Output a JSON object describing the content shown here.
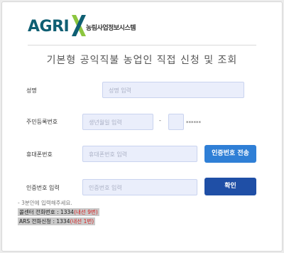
{
  "logo": {
    "brand": "AGRI",
    "brand_x": "X",
    "subtitle": "농림사업정보시스템"
  },
  "title": "기본형 공익직불 농업인 직접 신청 및 조회",
  "form": {
    "name": {
      "label": "성명",
      "placeholder": "성명 입력"
    },
    "resident": {
      "label": "주민등록번호",
      "birth_placeholder": "생년월일 입력",
      "dash": "-",
      "mask": "******"
    },
    "phone": {
      "label": "휴대폰번호",
      "placeholder": "휴대폰번호 입력",
      "send_button": "인증번호 전송"
    },
    "auth": {
      "label": "인증번호 입력",
      "placeholder": "인증번호 입력",
      "confirm_button": "확인"
    }
  },
  "notes": {
    "hint": "- 3분안에 입력해주세요.",
    "callcenter_prefix": "콜센터 전화번호 : 1334",
    "callcenter_ext": "(내선 9번)",
    "ars_prefix": "ARS 전화신청 : 1334",
    "ars_ext": "(내선 1번)"
  },
  "colors": {
    "brand_teal": "#0f5f73",
    "brand_green": "#8cc63f",
    "accent_blue": "#2f7fd6",
    "confirm_blue": "#1f4fa6",
    "input_bg": "#eaeefb",
    "note_red": "#d62020"
  }
}
